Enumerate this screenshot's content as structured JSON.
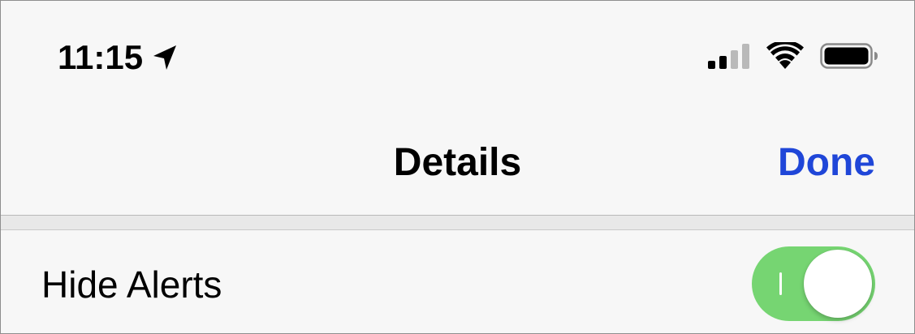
{
  "status_bar": {
    "time": "11:15",
    "icons": {
      "location": "location-arrow-icon",
      "signal": "cellular-signal-icon",
      "wifi": "wifi-icon",
      "battery": "battery-icon"
    }
  },
  "nav": {
    "title": "Details",
    "done_label": "Done"
  },
  "cell": {
    "label": "Hide Alerts",
    "toggle_on": true
  },
  "colors": {
    "accent": "#1f46d8",
    "toggle_on": "#76d572",
    "background": "#f7f7f7",
    "group_gap": "#e8e8e8"
  }
}
